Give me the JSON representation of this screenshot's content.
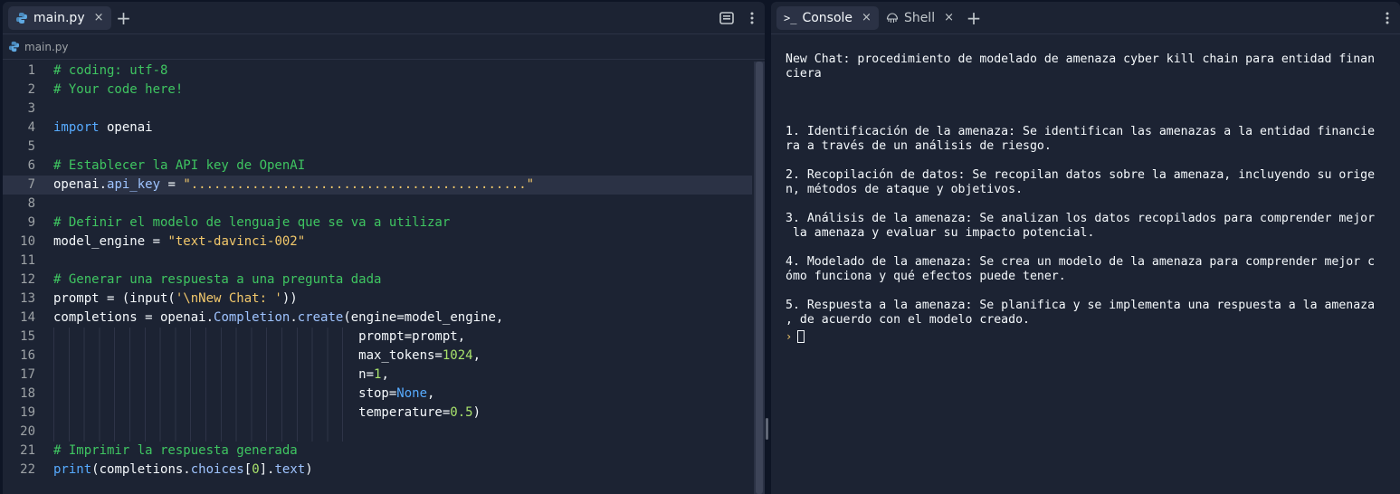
{
  "editor": {
    "tab_label": "main.py",
    "tab_close": "×",
    "add_tab": "+",
    "breadcrumb": "main.py",
    "lines": [
      {
        "n": "1",
        "tokens": [
          {
            "t": "# coding: utf-8",
            "c": "comment"
          }
        ]
      },
      {
        "n": "2",
        "tokens": [
          {
            "t": "# Your code here!",
            "c": "comment"
          }
        ]
      },
      {
        "n": "3",
        "tokens": []
      },
      {
        "n": "4",
        "tokens": [
          {
            "t": "import",
            "c": "kw"
          },
          {
            "t": " openai",
            "c": ""
          }
        ]
      },
      {
        "n": "5",
        "tokens": []
      },
      {
        "n": "6",
        "tokens": [
          {
            "t": "# Establecer la API key de OpenAI",
            "c": "comment"
          }
        ]
      },
      {
        "n": "7",
        "current": true,
        "tokens": [
          {
            "t": "openai.",
            "c": ""
          },
          {
            "t": "api_key",
            "c": "attr"
          },
          {
            "t": " = ",
            "c": ""
          },
          {
            "t": "\"............................................\"",
            "c": "str"
          }
        ]
      },
      {
        "n": "8",
        "tokens": []
      },
      {
        "n": "9",
        "tokens": [
          {
            "t": "# Definir el modelo de lenguaje que se va a utilizar",
            "c": "comment"
          }
        ]
      },
      {
        "n": "10",
        "tokens": [
          {
            "t": "model_engine = ",
            "c": ""
          },
          {
            "t": "\"text-davinci-002\"",
            "c": "str"
          }
        ]
      },
      {
        "n": "11",
        "tokens": []
      },
      {
        "n": "12",
        "tokens": [
          {
            "t": "# Generar una respuesta a una pregunta dada",
            "c": "comment"
          }
        ]
      },
      {
        "n": "13",
        "tokens": [
          {
            "t": "prompt = (input(",
            "c": ""
          },
          {
            "t": "'\\nNew Chat: '",
            "c": "str"
          },
          {
            "t": "))",
            "c": ""
          }
        ]
      },
      {
        "n": "14",
        "tokens": [
          {
            "t": "completions = openai.",
            "c": ""
          },
          {
            "t": "Completion",
            "c": "attr"
          },
          {
            "t": ".",
            "c": ""
          },
          {
            "t": "create",
            "c": "attr"
          },
          {
            "t": "(engine=model_engine,",
            "c": ""
          }
        ]
      },
      {
        "n": "15",
        "guides": true,
        "tokens": [
          {
            "t": "                                        prompt=prompt,",
            "c": ""
          }
        ]
      },
      {
        "n": "16",
        "guides": true,
        "tokens": [
          {
            "t": "                                        max_tokens=",
            "c": ""
          },
          {
            "t": "1024",
            "c": "num"
          },
          {
            "t": ",",
            "c": ""
          }
        ]
      },
      {
        "n": "17",
        "guides": true,
        "tokens": [
          {
            "t": "                                        n=",
            "c": ""
          },
          {
            "t": "1",
            "c": "num"
          },
          {
            "t": ",",
            "c": ""
          }
        ]
      },
      {
        "n": "18",
        "guides": true,
        "tokens": [
          {
            "t": "                                        stop=",
            "c": ""
          },
          {
            "t": "None",
            "c": "kw"
          },
          {
            "t": ",",
            "c": ""
          }
        ]
      },
      {
        "n": "19",
        "guides": true,
        "tokens": [
          {
            "t": "                                        temperature=",
            "c": ""
          },
          {
            "t": "0.5",
            "c": "num"
          },
          {
            "t": ")",
            "c": ""
          }
        ]
      },
      {
        "n": "20",
        "guides": true,
        "tokens": []
      },
      {
        "n": "21",
        "tokens": [
          {
            "t": "# Imprimir la respuesta generada",
            "c": "comment"
          }
        ]
      },
      {
        "n": "22",
        "tokens": [
          {
            "t": "print",
            "c": "kw"
          },
          {
            "t": "(completions.",
            "c": ""
          },
          {
            "t": "choices",
            "c": "attr"
          },
          {
            "t": "[",
            "c": ""
          },
          {
            "t": "0",
            "c": "num"
          },
          {
            "t": "].",
            "c": ""
          },
          {
            "t": "text",
            "c": "attr"
          },
          {
            "t": ")",
            "c": ""
          }
        ]
      }
    ]
  },
  "console": {
    "tabs": [
      {
        "label": "Console",
        "icon": "terminal-icon",
        "close": "×",
        "active": true
      },
      {
        "label": "Shell",
        "icon": "shell-icon",
        "close": "×",
        "active": false
      }
    ],
    "add_tab": "+",
    "header_lines": "New Chat: procedimiento de modelado de amenaza cyber kill chain para entidad finan\nciera",
    "paragraphs": [
      "1. Identificación de la amenaza: Se identifican las amenazas a la entidad financie\nra a través de un análisis de riesgo.",
      "2. Recopilación de datos: Se recopilan datos sobre la amenaza, incluyendo su orige\nn, métodos de ataque y objetivos.",
      "3. Análisis de la amenaza: Se analizan los datos recopilados para comprender mejor\n la amenaza y evaluar su impacto potencial.",
      "4. Modelado de la amenaza: Se crea un modelo de la amenaza para comprender mejor c\nómo funciona y qué efectos puede tener.",
      "5. Respuesta a la amenaza: Se planifica y se implementa una respuesta a la amenaza\n, de acuerdo con el modelo creado."
    ],
    "prompt_glyph": "›"
  },
  "colors": {
    "background": "#0e1525",
    "pane": "#1c2333",
    "comment": "#3fc561",
    "keyword": "#57abff",
    "string": "#f2c86b",
    "number": "#a8e26b"
  }
}
